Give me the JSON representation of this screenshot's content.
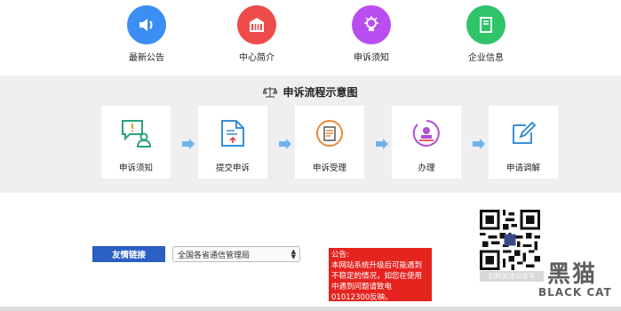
{
  "nav": {
    "items": [
      {
        "label": "最新公告",
        "icon": "speaker-icon",
        "color": "#3b8ef3"
      },
      {
        "label": "中心简介",
        "icon": "building-icon",
        "color": "#ee4b4b"
      },
      {
        "label": "申诉须知",
        "icon": "lightbulb-icon",
        "color": "#b94ef0"
      },
      {
        "label": "企业信息",
        "icon": "book-icon",
        "color": "#2fc46a"
      }
    ]
  },
  "process": {
    "title": "申诉流程示意图",
    "steps": [
      {
        "label": "申诉须知",
        "icon": "chat-person-icon"
      },
      {
        "label": "提交申诉",
        "icon": "document-upload-icon"
      },
      {
        "label": "申诉受理",
        "icon": "clipboard-icon"
      },
      {
        "label": "办理",
        "icon": "stamp-icon"
      },
      {
        "label": "申请调解",
        "icon": "edit-icon"
      }
    ]
  },
  "links": {
    "button_label": "友情链接",
    "selected": "全国各省通信管理局"
  },
  "notice": {
    "title": "公告:",
    "body": "本网站系统升级后可能遇到不稳定的情况，如您在使用中遇到问题请致电01012300反映。"
  },
  "qr": {
    "caption": "扫码关注公众号"
  },
  "watermark": {
    "cn": "黑猫",
    "en": "BLACK CAT"
  },
  "colors": {
    "band": "#efefef",
    "button": "#2a5fc4",
    "notice": "#e52420",
    "arrow": "#6fb3ec"
  }
}
